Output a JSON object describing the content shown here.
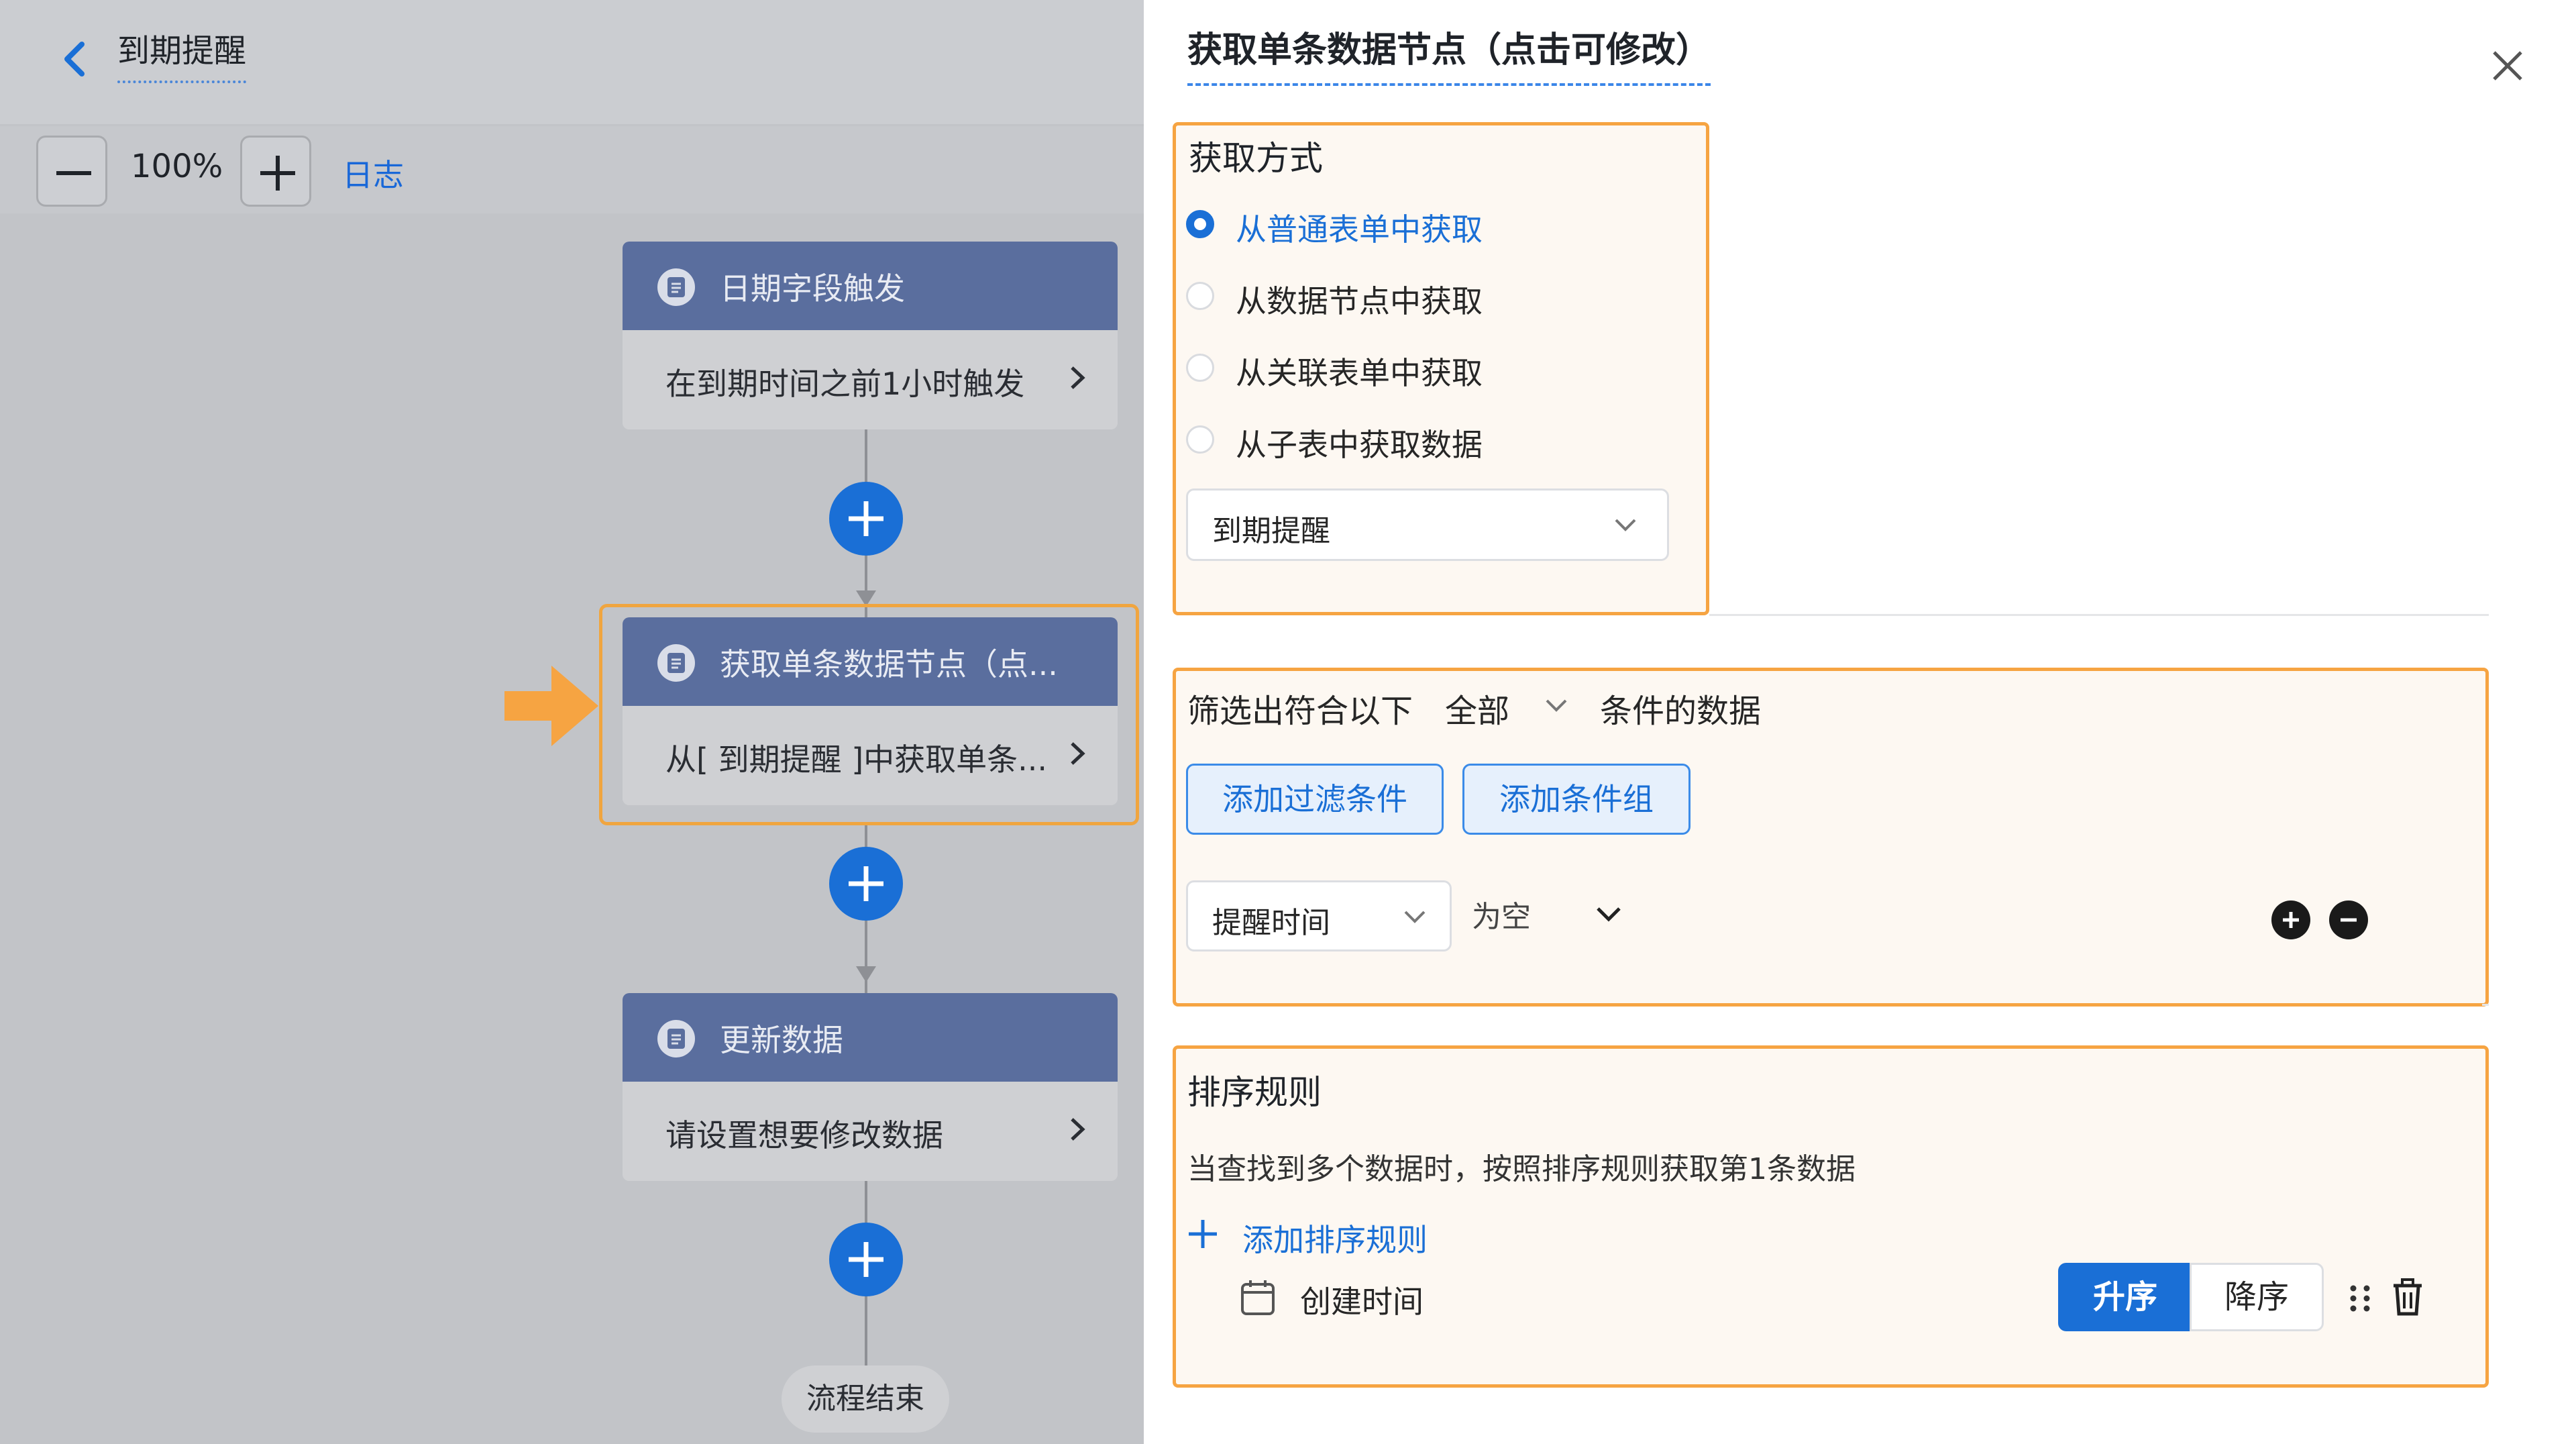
{
  "flow": {
    "title": "到期提醒",
    "toolbar": {
      "zoom_level": "100%",
      "log_label": "日志"
    },
    "nodes": [
      {
        "title": "日期字段触发",
        "description": "在到期时间之前1小时触发"
      },
      {
        "title": "获取单条数据节点（点...",
        "description": "从[ 到期提醒 ]中获取单条..."
      },
      {
        "title": "更新数据",
        "description": "请设置想要修改数据"
      }
    ],
    "end_label": "流程结束"
  },
  "panel": {
    "title": "获取单条数据节点（点击可修改）",
    "method": {
      "heading": "获取方式",
      "options": [
        {
          "label": "从普通表单中获取",
          "checked": true
        },
        {
          "label": "从数据节点中获取",
          "checked": false
        },
        {
          "label": "从关联表单中获取",
          "checked": false
        },
        {
          "label": "从子表中获取数据",
          "checked": false
        }
      ],
      "form_select": "到期提醒"
    },
    "filter": {
      "prefix": "筛选出符合以下",
      "scope": "全部",
      "suffix": "条件的数据",
      "add_condition": "添加过滤条件",
      "add_group": "添加条件组",
      "condition": {
        "field": "提醒时间",
        "operator": "为空"
      }
    },
    "sort": {
      "heading": "排序规则",
      "description": "当查找到多个数据时，按照排序规则获取第1条数据",
      "add_rule": "添加排序规则",
      "rule": {
        "field": "创建时间",
        "asc": "升序",
        "desc": "降序",
        "selected": "升序"
      }
    }
  },
  "colors": {
    "primary": "#1a6fd6",
    "highlight": "#f6a442",
    "node_header": "#5a6e9e",
    "section_bg": "#fdf8f2"
  },
  "icons": {
    "back": "chevron-left-icon",
    "close": "close-icon",
    "node": "document-icon",
    "add": "plus-icon",
    "drag": "drag-handle-icon",
    "delete": "trash-icon",
    "calendar": "calendar-icon"
  }
}
